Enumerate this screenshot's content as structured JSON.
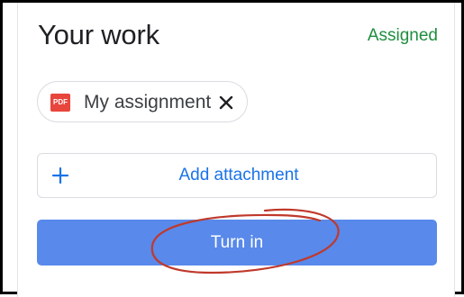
{
  "header": {
    "title": "Your work",
    "status": "Assigned"
  },
  "attachment_chip": {
    "file_type_badge": "PDF",
    "file_name": "My assignment",
    "icon": "pdf-file-icon",
    "remove_icon": "close-icon"
  },
  "add_attachment": {
    "label": "Add attachment",
    "icon": "plus-icon"
  },
  "turn_in": {
    "label": "Turn in"
  },
  "colors": {
    "status_green": "#1e8e3e",
    "accent_blue": "#1a73e8",
    "primary_button": "#5889eb",
    "pdf_red": "#e8453c",
    "annotation_red": "#c0392b"
  }
}
